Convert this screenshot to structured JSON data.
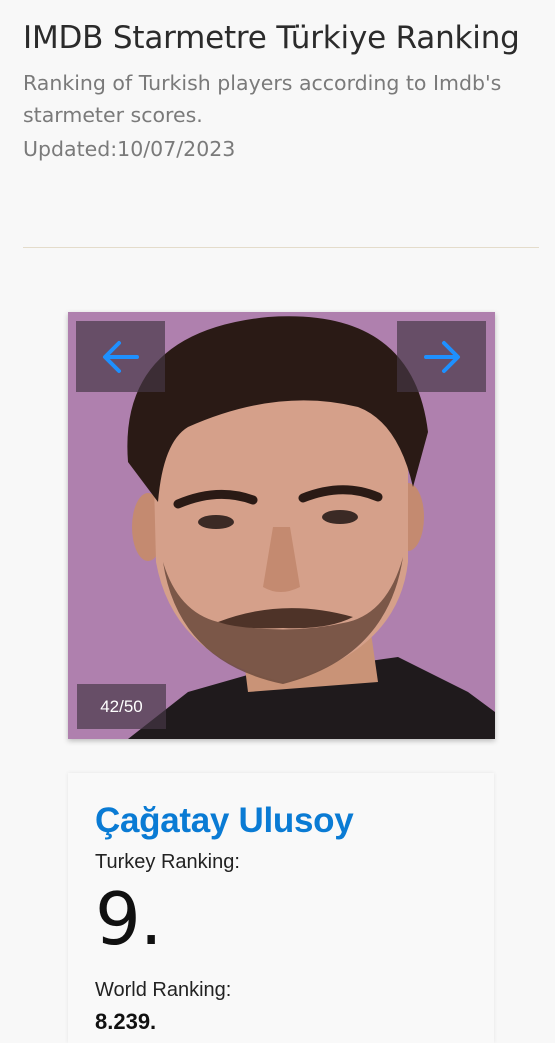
{
  "header": {
    "title": "IMDB Starmetre Türkiye Ranking",
    "subtitle": "Ranking of Turkish players according to Imdb's starmeter scores.",
    "updated": "Updated:10/07/2023"
  },
  "slider": {
    "counter": "42/50",
    "prev_icon": "arrow-left-icon",
    "next_icon": "arrow-right-icon",
    "arrow_color": "#1e90ff"
  },
  "actor": {
    "name": "Çağatay Ulusoy",
    "turkey_label": "Turkey Ranking:",
    "turkey_rank": "9.",
    "world_label": "World Ranking:",
    "world_rank": "8.239."
  },
  "colors": {
    "name": "#0a7bd4",
    "divider": "#e4dccb",
    "photo_background": "#b07fae"
  }
}
